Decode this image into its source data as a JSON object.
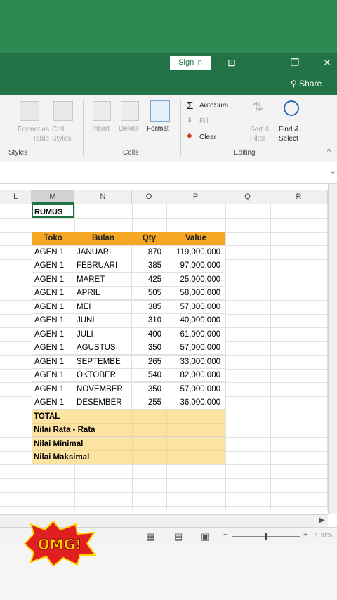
{
  "titlebar": {
    "signin": "Sign in",
    "share": "Share"
  },
  "ribbon": {
    "styles_group": {
      "format_as_table": "Format as Table",
      "cell_styles": "Cell Styles",
      "name": "Styles"
    },
    "cells_group": {
      "insert": "Insert",
      "delete": "Delete",
      "format": "Format",
      "name": "Cells"
    },
    "editing_group": {
      "autosum": "AutoSum",
      "fill": "Fill",
      "clear": "Clear",
      "sort_filter": "Sort & Filter",
      "find_select": "Find & Select",
      "name": "Editing"
    }
  },
  "columns": [
    "L",
    "M",
    "N",
    "O",
    "P",
    "Q",
    "R"
  ],
  "selected_cell_text": "RUMUS",
  "table": {
    "headers": [
      "Toko",
      "Bulan",
      "Qty",
      "Value"
    ],
    "rows": [
      [
        "AGEN 1",
        "JANUARI",
        "870",
        "119,000,000"
      ],
      [
        "AGEN 1",
        "FEBRUARI",
        "385",
        "97,000,000"
      ],
      [
        "AGEN 1",
        "MARET",
        "425",
        "25,000,000"
      ],
      [
        "AGEN 1",
        "APRIL",
        "505",
        "58,000,000"
      ],
      [
        "AGEN 1",
        "MEI",
        "385",
        "57,000,000"
      ],
      [
        "AGEN 1",
        "JUNI",
        "310",
        "40,000,000"
      ],
      [
        "AGEN 1",
        "JULI",
        "400",
        "61,000,000"
      ],
      [
        "AGEN 1",
        "AGUSTUS",
        "350",
        "57,000,000"
      ],
      [
        "AGEN 1",
        "SEPTEMBE",
        "265",
        "33,000,000"
      ],
      [
        "AGEN 1",
        "OKTOBER",
        "540",
        "82,000,000"
      ],
      [
        "AGEN 1",
        "NOVEMBER",
        "350",
        "57,000,000"
      ],
      [
        "AGEN 1",
        "DESEMBER",
        "255",
        "36,000,000"
      ]
    ],
    "summary": [
      "TOTAL",
      "Nilai Rata - Rata",
      "Nilai Minimal",
      "Nilai Maksimal"
    ]
  },
  "status": {
    "zoom": "100%"
  },
  "sticker": "OMG!",
  "colors": {
    "excel_green": "#217346",
    "header_orange": "#f5a623",
    "total_fill": "#fde3a1"
  }
}
